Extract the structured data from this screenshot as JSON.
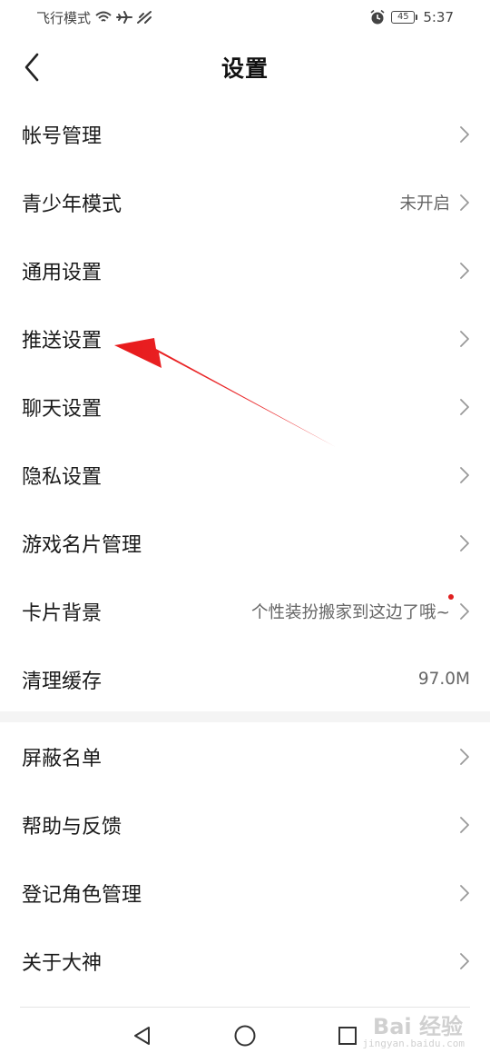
{
  "status_bar": {
    "left_text": "飞行模式",
    "time": "5:37",
    "battery": "45",
    "icons": [
      "wifi-icon",
      "airplane-icon",
      "no-signal-icon",
      "alarm-icon",
      "battery-icon"
    ]
  },
  "header": {
    "title": "设置",
    "back_icon": "chevron-left-icon"
  },
  "section_main": [
    {
      "id": "account",
      "label": "帐号管理",
      "value": ""
    },
    {
      "id": "teen-mode",
      "label": "青少年模式",
      "value": "未开启"
    },
    {
      "id": "general",
      "label": "通用设置",
      "value": ""
    },
    {
      "id": "push",
      "label": "推送设置",
      "value": ""
    },
    {
      "id": "chat",
      "label": "聊天设置",
      "value": ""
    },
    {
      "id": "privacy",
      "label": "隐私设置",
      "value": ""
    },
    {
      "id": "game-card",
      "label": "游戏名片管理",
      "value": ""
    },
    {
      "id": "card-bg",
      "label": "卡片背景",
      "value": "个性装扮搬家到这边了哦~"
    },
    {
      "id": "clear-cache",
      "label": "清理缓存",
      "value": "97.0M"
    }
  ],
  "section_secondary": [
    {
      "id": "block-list",
      "label": "屏蔽名单",
      "value": ""
    },
    {
      "id": "help",
      "label": "帮助与反馈",
      "value": ""
    },
    {
      "id": "role-manage",
      "label": "登记角色管理",
      "value": ""
    },
    {
      "id": "about",
      "label": "关于大神",
      "value": ""
    }
  ],
  "system_nav": {
    "icons": [
      "back-triangle-icon",
      "home-circle-icon",
      "recents-square-icon"
    ]
  },
  "watermark": {
    "text": "Bai 经验",
    "sub": "jingyan.baidu.com"
  },
  "colors": {
    "arrow": "#e8191b",
    "red_dot": "#e02020",
    "divider_bg": "#f4f4f4",
    "value_text": "#666666"
  }
}
